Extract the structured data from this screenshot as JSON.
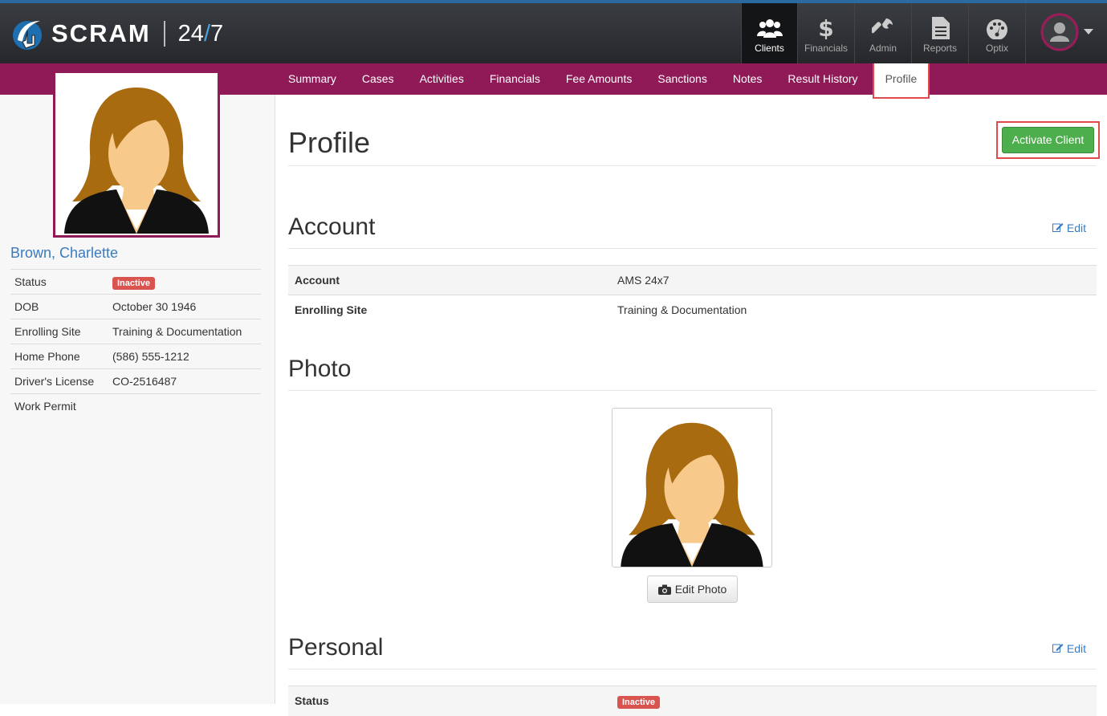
{
  "brand": {
    "name": "SCRAM",
    "hours_a": "24",
    "hours_slash": "/",
    "hours_b": "7"
  },
  "nav": [
    {
      "label": "Clients",
      "icon": "users-icon",
      "active": true
    },
    {
      "label": "Financials",
      "icon": "dollar-icon"
    },
    {
      "label": "Admin",
      "icon": "wrench-icon"
    },
    {
      "label": "Reports",
      "icon": "document-icon"
    },
    {
      "label": "Optix",
      "icon": "gauge-icon"
    }
  ],
  "tabs": [
    "Summary",
    "Cases",
    "Activities",
    "Financials",
    "Fee Amounts",
    "Sanctions",
    "Notes",
    "Result History",
    "Profile"
  ],
  "client": {
    "name": "Brown, Charlette",
    "info": [
      {
        "label": "Status",
        "value": "Inactive"
      },
      {
        "label": "DOB",
        "value": "October 30 1946"
      },
      {
        "label": "Enrolling Site",
        "value": "Training & Documentation"
      },
      {
        "label": "Home Phone",
        "value": "(586) 555-1212"
      },
      {
        "label": "Driver's License",
        "value": "CO-2516487"
      },
      {
        "label": "Work Permit",
        "value": ""
      }
    ]
  },
  "page": {
    "title": "Profile",
    "activate_label": "Activate Client",
    "edit_label": "Edit",
    "account_heading": "Account",
    "account_rows": [
      {
        "label": "Account",
        "value": "AMS 24x7"
      },
      {
        "label": "Enrolling Site",
        "value": "Training & Documentation"
      }
    ],
    "photo_heading": "Photo",
    "edit_photo_label": "Edit Photo",
    "personal_heading": "Personal",
    "personal_rows": [
      {
        "label": "Status",
        "value": "Inactive"
      }
    ]
  },
  "colors": {
    "accent": "#8f1a57",
    "link": "#3a7bbf",
    "success": "#4cae4c",
    "danger": "#d9534f"
  }
}
